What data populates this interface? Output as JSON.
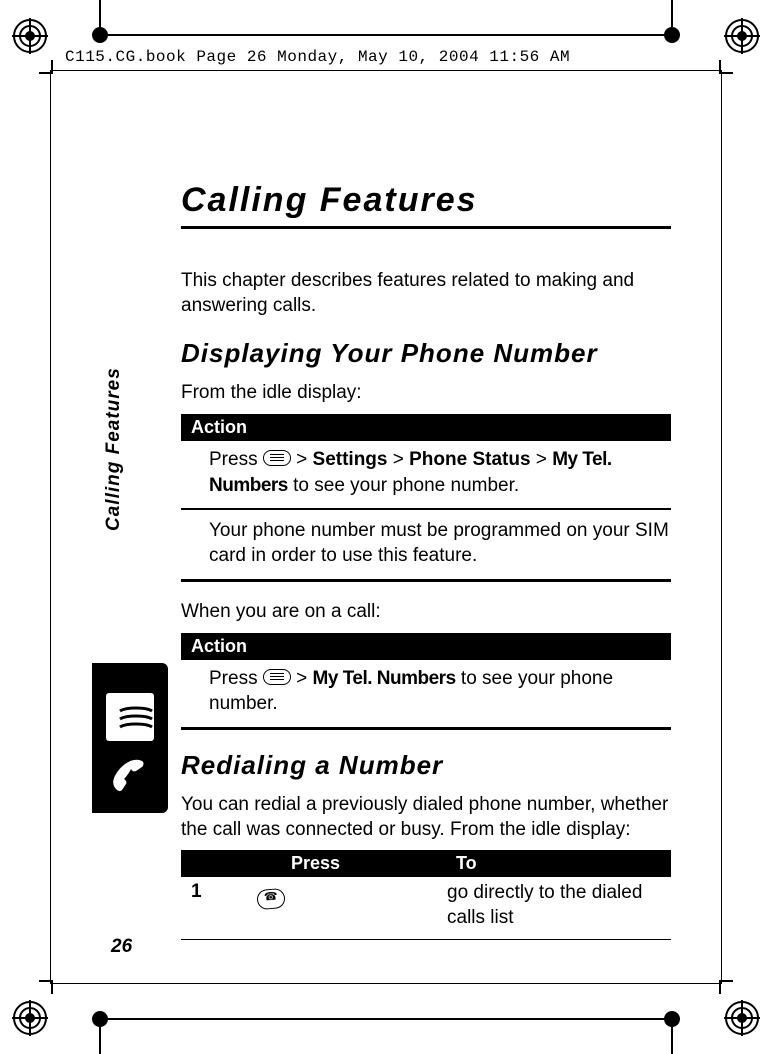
{
  "meta": {
    "header_line": "C115.CG.book  Page 26  Monday, May 10, 2004  11:56 AM"
  },
  "page": {
    "title": "Calling Features",
    "intro": "This chapter describes features related to making and answering calls.",
    "number": "26",
    "side_label": "Calling Features"
  },
  "s1": {
    "heading": "Displaying Your Phone Number",
    "lead": "From the idle display:",
    "action_label": "Action",
    "a1_pre": "Press ",
    "a1_gt1": " > ",
    "a1_settings": "Settings",
    "a1_gt2": " > ",
    "a1_phonestatus": "Phone Status",
    "a1_gt3": " > ",
    "a1_mytel": "My Tel. Numbers",
    "a1_post": " to see your phone number.",
    "note": "Your phone number must be programmed on your SIM card in order to use this feature.",
    "lead2": "When you are on a call:",
    "action_label2": "Action",
    "a2_pre": "Press ",
    "a2_gt": " > ",
    "a2_mytel": "My Tel. Numbers",
    "a2_post": " to see your phone number."
  },
  "s2": {
    "heading": "Redialing a Number",
    "lead": "You can redial a previously dialed phone number, whether the call was connected or busy. From the idle display:",
    "col_press": "Press",
    "col_to": "To",
    "row1_num": "1",
    "row1_to": "go directly to the dialed calls list"
  }
}
